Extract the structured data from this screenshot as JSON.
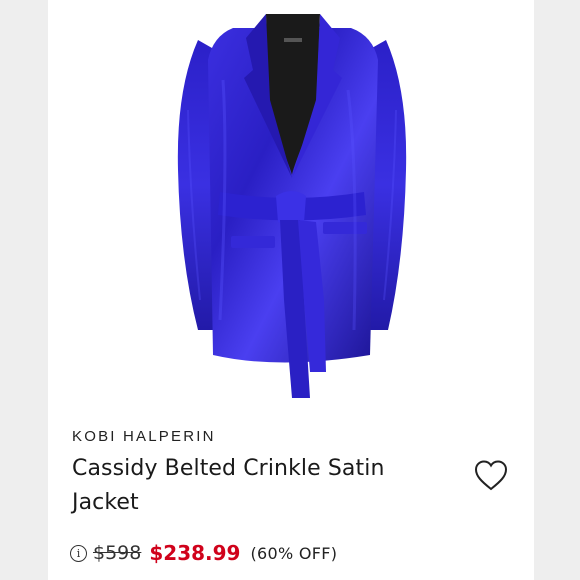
{
  "product": {
    "brand": "KOBI HALPERIN",
    "title": "Cassidy Belted Crinkle Satin Jacket",
    "original_price": "$598",
    "sale_price": "$238.99",
    "discount": "(60% OFF)"
  },
  "colors": {
    "jacket": "#2a1fc4",
    "sale_price": "#d0021b"
  },
  "icons": {
    "wishlist": "heart-outline-icon",
    "info": "info-circle-icon"
  }
}
